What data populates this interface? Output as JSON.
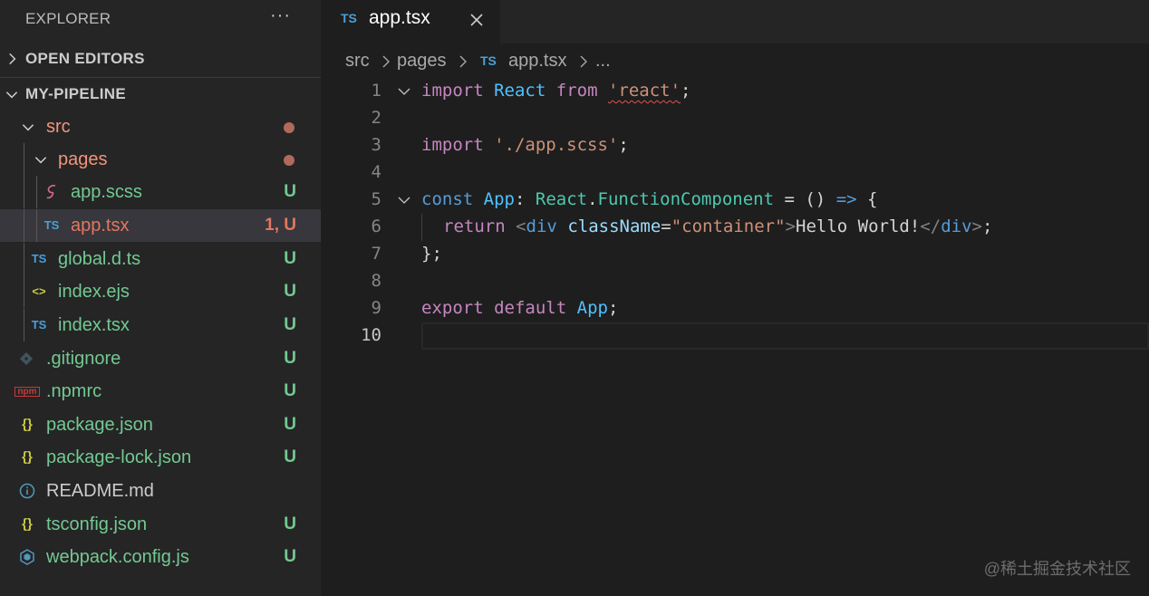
{
  "explorer": {
    "title": "EXPLORER",
    "more_label": "···",
    "open_editors_label": "OPEN EDITORS",
    "project_label": "MY-PIPELINE",
    "tree": [
      {
        "name": "src",
        "status": ""
      },
      {
        "name": "pages",
        "status": ""
      },
      {
        "name": "app.scss",
        "status": "U"
      },
      {
        "name": "app.tsx",
        "status": "1, U"
      },
      {
        "name": "global.d.ts",
        "status": "U"
      },
      {
        "name": "index.ejs",
        "status": "U"
      },
      {
        "name": "index.tsx",
        "status": "U"
      },
      {
        "name": ".gitignore",
        "status": "U"
      },
      {
        "name": ".npmrc",
        "status": "U"
      },
      {
        "name": "package.json",
        "status": "U"
      },
      {
        "name": "package-lock.json",
        "status": "U"
      },
      {
        "name": "README.md",
        "status": ""
      },
      {
        "name": "tsconfig.json",
        "status": "U"
      },
      {
        "name": "webpack.config.js",
        "status": "U"
      }
    ],
    "icon_labels": {
      "ts": "TS",
      "json": "{}",
      "ejs": "<>",
      "npm": "npm"
    }
  },
  "tab": {
    "label": "app.tsx",
    "lang": "TS"
  },
  "breadcrumb": {
    "parts": [
      "src",
      "pages",
      "app.tsx",
      "..."
    ],
    "lang": "TS"
  },
  "editor": {
    "line_numbers": [
      "1",
      "2",
      "3",
      "4",
      "5",
      "6",
      "7",
      "8",
      "9",
      "10"
    ],
    "tokens": {
      "import": "import",
      "React": "React",
      "from": "from",
      "react_str": "'react'",
      "semi": ";",
      "scss_str": "'./app.scss'",
      "const": "const",
      "App": "App",
      "colon": ":",
      "FunctionComponent": "FunctionComponent",
      "dot": ".",
      "eq": " = ",
      "parens": "()",
      "arrow": "=>",
      "brace_open": "{",
      "return": "return",
      "tag_open": "<",
      "div": "div",
      "className": "className",
      "eq_sign": "=",
      "container_str": "\"container\"",
      "tag_close": ">",
      "hello": "Hello World!",
      "end_tag_open": "</",
      "brace_close": "};",
      "export": "export",
      "default": "default"
    }
  },
  "watermark": "@稀土掘金技术社区",
  "colors": {
    "untracked": "#73c991",
    "error": "#e2775f",
    "modified_folder": "#f2957b",
    "ts_badge": "#4a9fd8",
    "json_badge": "#cbcb41"
  }
}
